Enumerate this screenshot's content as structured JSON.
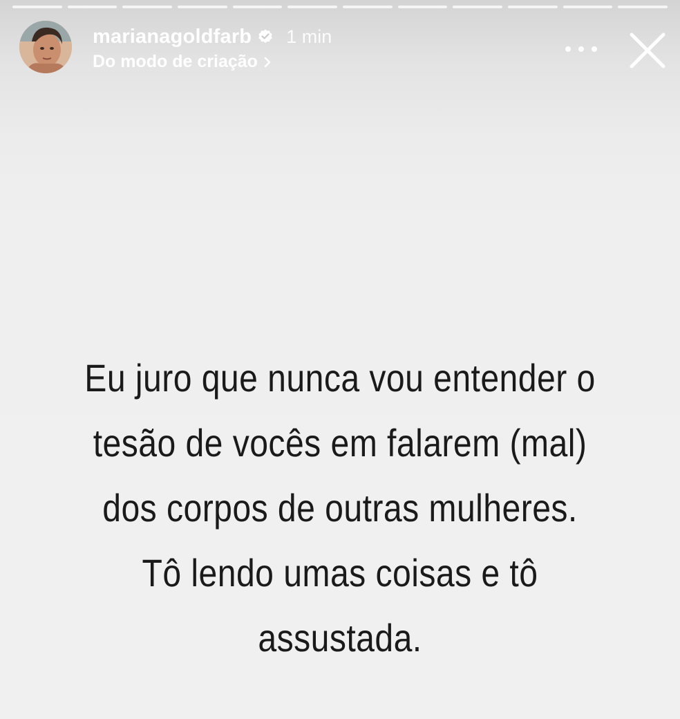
{
  "story": {
    "progress_segments": 12,
    "user": {
      "username": "marianagoldfarb",
      "verified": true,
      "time": "1 min",
      "source_label": "Do modo de criação",
      "avatar_icon": "avatar-photo"
    },
    "controls": {
      "more_icon": "more-horizontal-icon",
      "close_icon": "close-icon"
    },
    "caption_lines": [
      "Eu juro que nunca vou entender o",
      "tesão de vocês em falarem (mal)",
      "dos corpos de outras mulheres.",
      "Tô lendo umas coisas e tô",
      "assustada."
    ]
  }
}
